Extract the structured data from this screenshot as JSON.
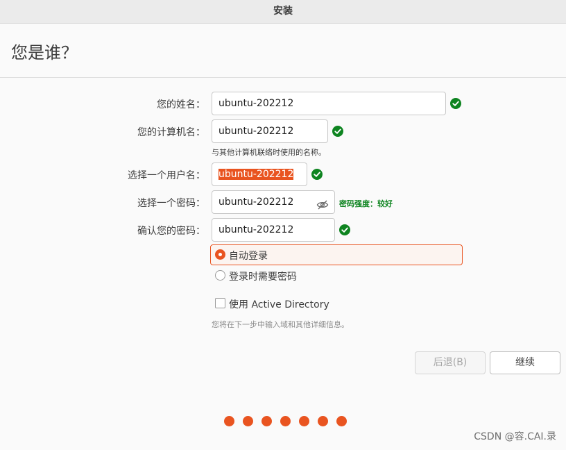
{
  "window": {
    "title": "安装"
  },
  "page": {
    "title": "您是谁？"
  },
  "form": {
    "name": {
      "label": "您的姓名：",
      "value": "ubuntu-202212"
    },
    "computer_name": {
      "label": "您的计算机名：",
      "value": "ubuntu-202212",
      "hint": "与其他计算机联络时使用的名称。"
    },
    "username": {
      "label": "选择一个用户名：",
      "value": "ubuntu-202212"
    },
    "password": {
      "label": "选择一个密码：",
      "value": "ubuntu-202212",
      "strength": "密码强度：较好"
    },
    "confirm_password": {
      "label": "确认您的密码：",
      "value": "ubuntu-202212"
    },
    "login_options": [
      {
        "label": "自动登录",
        "selected": true
      },
      {
        "label": "登录时需要密码",
        "selected": false
      }
    ],
    "active_directory": {
      "label": "使用 Active Directory",
      "checked": false,
      "hint": "您将在下一步中输入域和其他详细信息。"
    }
  },
  "buttons": {
    "back_label": "后退(B)",
    "continue_label": "继续"
  },
  "progress": {
    "steps_shown": 7
  },
  "colors": {
    "accent": "#e95420",
    "success": "#0e8420"
  },
  "watermark": "CSDN @容.CAI.录"
}
